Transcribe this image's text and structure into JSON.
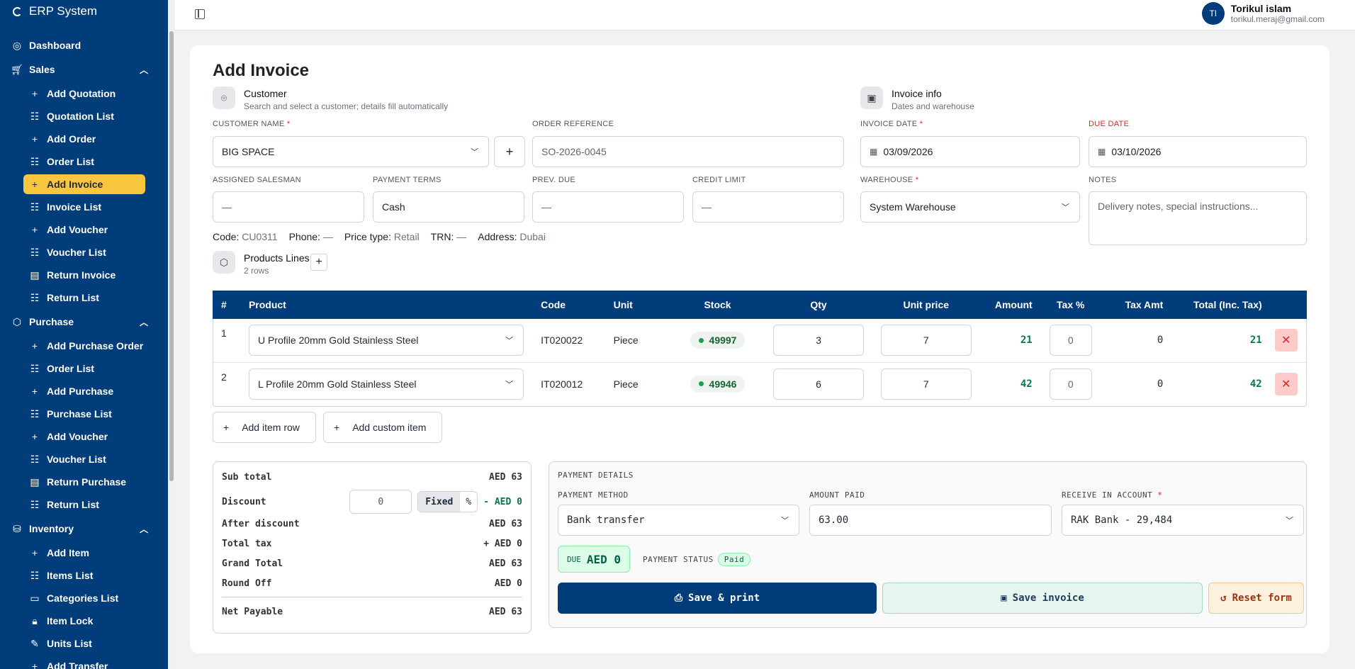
{
  "app": {
    "title": "ERP System"
  },
  "sidebar": {
    "dashboard": "Dashboard",
    "sales": {
      "label": "Sales",
      "items": [
        "Add Quotation",
        "Quotation List",
        "Add Order",
        "Order List",
        "Add Invoice",
        "Invoice List",
        "Add Voucher",
        "Voucher List",
        "Return Invoice",
        "Return List"
      ]
    },
    "purchase": {
      "label": "Purchase",
      "items": [
        "Add Purchase Order",
        "Order List",
        "Add Purchase",
        "Purchase List",
        "Add Voucher",
        "Voucher List",
        "Return Purchase",
        "Return List"
      ]
    },
    "inventory": {
      "label": "Inventory",
      "items": [
        "Add Item",
        "Items List",
        "Categories List",
        "Item Lock",
        "Units List",
        "Add Transfer"
      ]
    },
    "active_item": "Add Invoice"
  },
  "user": {
    "initials": "TI",
    "name": "Torikul islam",
    "email": "torikul.meraj@gmail.com"
  },
  "page": {
    "title": "Add Invoice"
  },
  "customer_section": {
    "title": "Customer",
    "subtitle": "Search and select a customer; details fill automatically"
  },
  "invoice_section": {
    "title": "Invoice info",
    "subtitle": "Dates and warehouse"
  },
  "fields": {
    "customer_name": {
      "label": "CUSTOMER NAME",
      "value": "BIG SPACE"
    },
    "order_reference": {
      "label": "ORDER REFERENCE",
      "placeholder": "SO-2026-0045"
    },
    "invoice_date": {
      "label": "INVOICE DATE",
      "value": "03/09/2026"
    },
    "due_date": {
      "label": "DUE DATE",
      "value": "03/10/2026"
    },
    "assigned_salesman": {
      "label": "ASSIGNED SALESMAN",
      "value": "—"
    },
    "payment_terms": {
      "label": "PAYMENT TERMS",
      "value": "Cash"
    },
    "prev_due": {
      "label": "PREV. DUE",
      "value": "—"
    },
    "credit_limit": {
      "label": "CREDIT LIMIT",
      "value": "—"
    },
    "warehouse": {
      "label": "WAREHOUSE",
      "value": "System Warehouse"
    },
    "notes": {
      "label": "NOTES",
      "placeholder": "Delivery notes, special instructions..."
    }
  },
  "customer_info": {
    "code_label": "Code:",
    "code": "CU0311",
    "phone_label": "Phone:",
    "phone": "—",
    "price_type_label": "Price type:",
    "price_type": "Retail",
    "trn_label": "TRN:",
    "trn": "—",
    "address_label": "Address:",
    "address": "Dubai"
  },
  "products": {
    "title": "Products Lines",
    "count": "2 rows",
    "columns": [
      "#",
      "Product",
      "Code",
      "Unit",
      "Stock",
      "Qty",
      "Unit price",
      "Amount",
      "Tax %",
      "Tax Amt",
      "Total (Inc. Tax)"
    ],
    "rows": [
      {
        "n": "1",
        "product": "U Profile 20mm Gold Stainless Steel",
        "code": "IT020022",
        "unit": "Piece",
        "stock": "49997",
        "qty": "3",
        "price": "7",
        "amount": "21",
        "tax_pct": "0",
        "tax_amt": "0",
        "total": "21"
      },
      {
        "n": "2",
        "product": "L Profile 20mm Gold Stainless Steel",
        "code": "IT020012",
        "unit": "Piece",
        "stock": "49946",
        "qty": "6",
        "price": "7",
        "amount": "42",
        "tax_pct": "0",
        "tax_amt": "0",
        "total": "42"
      }
    ],
    "add_item_row": "Add item row",
    "add_custom_item": "Add custom item"
  },
  "summary": {
    "sub_total": {
      "label": "Sub total",
      "value": "AED 63"
    },
    "discount": {
      "label": "Discount",
      "input": "0",
      "fixed": "Fixed",
      "pct": "%",
      "value": "- AED 0"
    },
    "after_discount": {
      "label": "After discount",
      "value": "AED 63"
    },
    "total_tax": {
      "label": "Total tax",
      "value": "+ AED 0"
    },
    "grand_total": {
      "label": "Grand Total",
      "value": "AED 63"
    },
    "round_off": {
      "label": "Round Off",
      "value": "AED 0"
    },
    "net_payable": {
      "label": "Net Payable",
      "value": "AED 63"
    }
  },
  "payment": {
    "title": "PAYMENT DETAILS",
    "method_label": "PAYMENT METHOD",
    "method": "Bank transfer",
    "amount_label": "AMOUNT PAID",
    "amount": "63.00",
    "account_label": "RECEIVE IN ACCOUNT",
    "account": "RAK Bank - 29,484",
    "due_label": "DUE",
    "due_value": "AED 0",
    "status_label": "PAYMENT STATUS",
    "status": "Paid",
    "save_print": "Save & print",
    "save_invoice": "Save invoice",
    "reset": "Reset form"
  },
  "colors": {
    "primary": "#003d7a",
    "accent": "#f8c53f",
    "success": "#047857",
    "danger": "#dc2626"
  }
}
